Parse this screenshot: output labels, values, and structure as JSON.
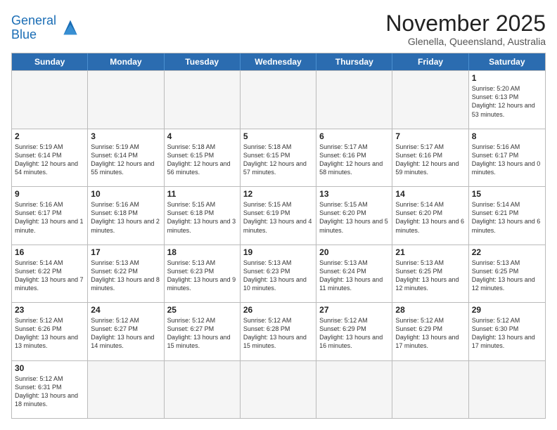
{
  "header": {
    "logo_general": "General",
    "logo_blue": "Blue",
    "month_title": "November 2025",
    "subtitle": "Glenella, Queensland, Australia"
  },
  "weekdays": [
    "Sunday",
    "Monday",
    "Tuesday",
    "Wednesday",
    "Thursday",
    "Friday",
    "Saturday"
  ],
  "weeks": [
    [
      {
        "day": "",
        "empty": true
      },
      {
        "day": "",
        "empty": true
      },
      {
        "day": "",
        "empty": true
      },
      {
        "day": "",
        "empty": true
      },
      {
        "day": "",
        "empty": true
      },
      {
        "day": "",
        "empty": true
      },
      {
        "day": "1",
        "sunrise": "5:20 AM",
        "sunset": "6:13 PM",
        "daylight": "12 hours and 53 minutes."
      }
    ],
    [
      {
        "day": "2",
        "sunrise": "5:19 AM",
        "sunset": "6:14 PM",
        "daylight": "12 hours and 54 minutes."
      },
      {
        "day": "3",
        "sunrise": "5:19 AM",
        "sunset": "6:14 PM",
        "daylight": "12 hours and 55 minutes."
      },
      {
        "day": "4",
        "sunrise": "5:18 AM",
        "sunset": "6:15 PM",
        "daylight": "12 hours and 56 minutes."
      },
      {
        "day": "5",
        "sunrise": "5:18 AM",
        "sunset": "6:15 PM",
        "daylight": "12 hours and 57 minutes."
      },
      {
        "day": "6",
        "sunrise": "5:17 AM",
        "sunset": "6:16 PM",
        "daylight": "12 hours and 58 minutes."
      },
      {
        "day": "7",
        "sunrise": "5:17 AM",
        "sunset": "6:16 PM",
        "daylight": "12 hours and 59 minutes."
      },
      {
        "day": "8",
        "sunrise": "5:16 AM",
        "sunset": "6:17 PM",
        "daylight": "13 hours and 0 minutes."
      }
    ],
    [
      {
        "day": "9",
        "sunrise": "5:16 AM",
        "sunset": "6:17 PM",
        "daylight": "13 hours and 1 minute."
      },
      {
        "day": "10",
        "sunrise": "5:16 AM",
        "sunset": "6:18 PM",
        "daylight": "13 hours and 2 minutes."
      },
      {
        "day": "11",
        "sunrise": "5:15 AM",
        "sunset": "6:18 PM",
        "daylight": "13 hours and 3 minutes."
      },
      {
        "day": "12",
        "sunrise": "5:15 AM",
        "sunset": "6:19 PM",
        "daylight": "13 hours and 4 minutes."
      },
      {
        "day": "13",
        "sunrise": "5:15 AM",
        "sunset": "6:20 PM",
        "daylight": "13 hours and 5 minutes."
      },
      {
        "day": "14",
        "sunrise": "5:14 AM",
        "sunset": "6:20 PM",
        "daylight": "13 hours and 6 minutes."
      },
      {
        "day": "15",
        "sunrise": "5:14 AM",
        "sunset": "6:21 PM",
        "daylight": "13 hours and 6 minutes."
      }
    ],
    [
      {
        "day": "16",
        "sunrise": "5:14 AM",
        "sunset": "6:22 PM",
        "daylight": "13 hours and 7 minutes."
      },
      {
        "day": "17",
        "sunrise": "5:13 AM",
        "sunset": "6:22 PM",
        "daylight": "13 hours and 8 minutes."
      },
      {
        "day": "18",
        "sunrise": "5:13 AM",
        "sunset": "6:23 PM",
        "daylight": "13 hours and 9 minutes."
      },
      {
        "day": "19",
        "sunrise": "5:13 AM",
        "sunset": "6:23 PM",
        "daylight": "13 hours and 10 minutes."
      },
      {
        "day": "20",
        "sunrise": "5:13 AM",
        "sunset": "6:24 PM",
        "daylight": "13 hours and 11 minutes."
      },
      {
        "day": "21",
        "sunrise": "5:13 AM",
        "sunset": "6:25 PM",
        "daylight": "13 hours and 12 minutes."
      },
      {
        "day": "22",
        "sunrise": "5:13 AM",
        "sunset": "6:25 PM",
        "daylight": "13 hours and 12 minutes."
      }
    ],
    [
      {
        "day": "23",
        "sunrise": "5:12 AM",
        "sunset": "6:26 PM",
        "daylight": "13 hours and 13 minutes."
      },
      {
        "day": "24",
        "sunrise": "5:12 AM",
        "sunset": "6:27 PM",
        "daylight": "13 hours and 14 minutes."
      },
      {
        "day": "25",
        "sunrise": "5:12 AM",
        "sunset": "6:27 PM",
        "daylight": "13 hours and 15 minutes."
      },
      {
        "day": "26",
        "sunrise": "5:12 AM",
        "sunset": "6:28 PM",
        "daylight": "13 hours and 15 minutes."
      },
      {
        "day": "27",
        "sunrise": "5:12 AM",
        "sunset": "6:29 PM",
        "daylight": "13 hours and 16 minutes."
      },
      {
        "day": "28",
        "sunrise": "5:12 AM",
        "sunset": "6:29 PM",
        "daylight": "13 hours and 17 minutes."
      },
      {
        "day": "29",
        "sunrise": "5:12 AM",
        "sunset": "6:30 PM",
        "daylight": "13 hours and 17 minutes."
      }
    ],
    [
      {
        "day": "30",
        "sunrise": "5:12 AM",
        "sunset": "6:31 PM",
        "daylight": "13 hours and 18 minutes."
      },
      {
        "day": "",
        "empty": true
      },
      {
        "day": "",
        "empty": true
      },
      {
        "day": "",
        "empty": true
      },
      {
        "day": "",
        "empty": true
      },
      {
        "day": "",
        "empty": true
      },
      {
        "day": "",
        "empty": true
      }
    ]
  ],
  "labels": {
    "sunrise": "Sunrise:",
    "sunset": "Sunset:",
    "daylight": "Daylight:"
  }
}
